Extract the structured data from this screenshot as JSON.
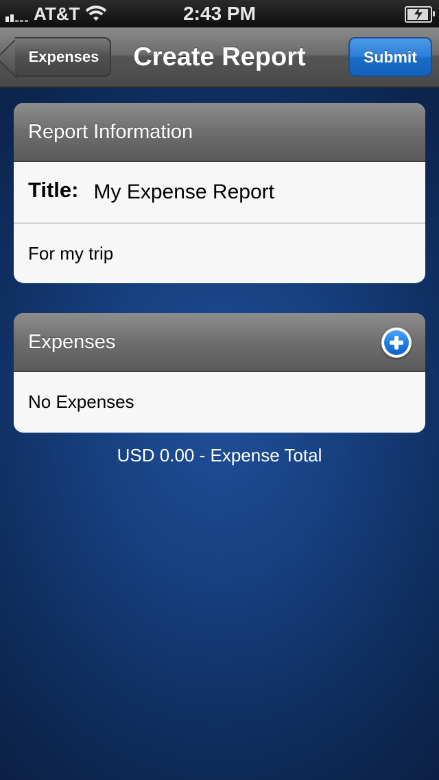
{
  "status_bar": {
    "carrier": "AT&T",
    "time": "2:43 PM",
    "icons": [
      "signal-icon",
      "wifi-icon",
      "battery-charging-icon"
    ]
  },
  "nav": {
    "back_label": "Expenses",
    "title": "Create Report",
    "submit_label": "Submit"
  },
  "report_info": {
    "header": "Report Information",
    "title_label": "Title:",
    "title_value": "My Expense Report",
    "description": "For my trip"
  },
  "expenses": {
    "header": "Expenses",
    "add_icon": "plus-circle-icon",
    "empty_text": "No Expenses"
  },
  "total": {
    "text": "USD 0.00 - Expense Total"
  },
  "colors": {
    "accent_blue": "#2d7fd8",
    "background_blue": "#16407f"
  }
}
